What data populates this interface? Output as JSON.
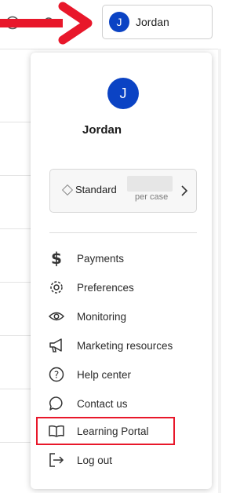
{
  "header": {
    "user_button": {
      "avatar_initial": "J",
      "name": "Jordan"
    }
  },
  "colors": {
    "avatar": "#0b43c4",
    "annotation_red": "#e8172a"
  },
  "dropdown": {
    "avatar_initial": "J",
    "user_name": "Jordan",
    "plan": {
      "icon": "diamond-icon",
      "name": "Standard",
      "unit": "per case",
      "chevron": "chevron-right-icon"
    },
    "menu": [
      {
        "icon": "dollar-icon",
        "label": "Payments"
      },
      {
        "icon": "gear-icon",
        "label": "Preferences"
      },
      {
        "icon": "eye-icon",
        "label": "Monitoring"
      },
      {
        "icon": "megaphone-icon",
        "label": "Marketing resources"
      },
      {
        "icon": "question-circle-icon",
        "label": "Help center"
      },
      {
        "icon": "chat-bubble-icon",
        "label": "Contact us"
      },
      {
        "icon": "book-icon",
        "label": "Learning Portal",
        "annotated": true
      },
      {
        "icon": "logout-icon",
        "label": "Log out"
      }
    ]
  },
  "annotations": {
    "arrow": "red-arrow-pointing-right",
    "highlight": "red-box-around-learning-portal"
  }
}
